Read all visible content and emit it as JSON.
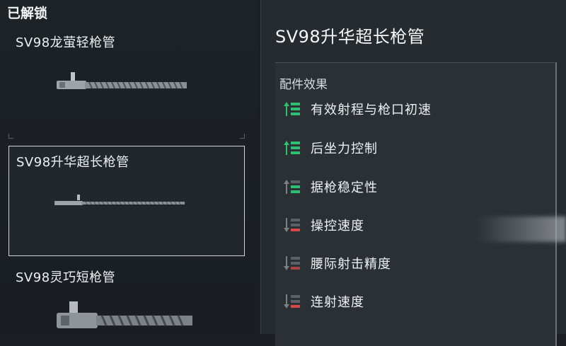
{
  "left": {
    "section_title": "已解锁",
    "parts": [
      {
        "name": "SV98龙萤轻枪管"
      },
      {
        "name": "SV98升华超长枪管"
      },
      {
        "name": "SV98灵巧短枪管"
      }
    ]
  },
  "detail": {
    "title": "SV98升华超长枪管",
    "effects_heading": "配件效果",
    "effects": [
      {
        "label": "有效射程与枪口初速",
        "icon": "stat-up-strong-icon",
        "color": "#2fbf71"
      },
      {
        "label": "后坐力控制",
        "icon": "stat-up-strong-icon",
        "color": "#2fbf71"
      },
      {
        "label": "据枪稳定性",
        "icon": "stat-up-weak-icon",
        "color": "#2fbf71"
      },
      {
        "label": "操控速度",
        "icon": "stat-down-icon",
        "color": "#d94848"
      },
      {
        "label": "腰际射击精度",
        "icon": "stat-down-weak-icon",
        "color": "#d94848"
      },
      {
        "label": "连射速度",
        "icon": "stat-down-icon",
        "color": "#d94848"
      }
    ]
  }
}
